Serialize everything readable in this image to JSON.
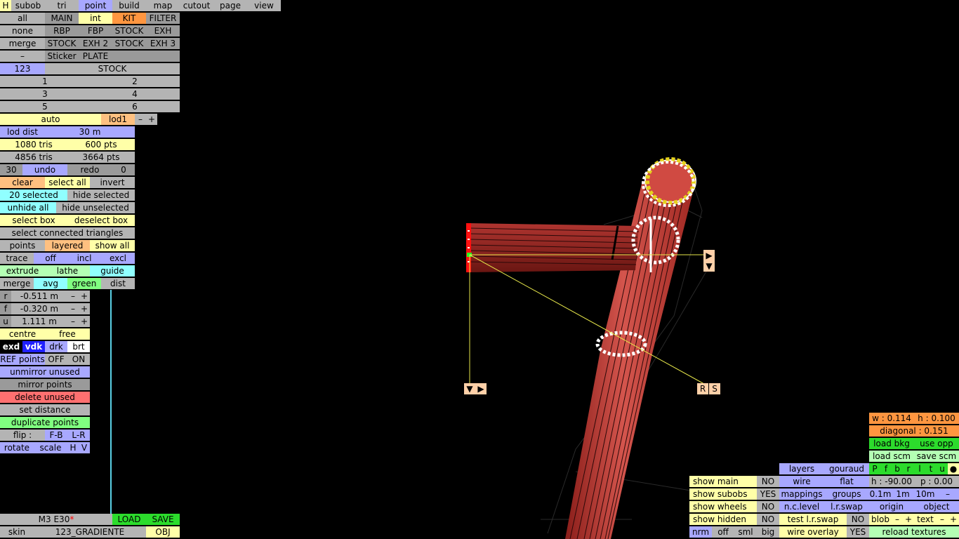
{
  "menu": {
    "h": "H",
    "subob": "subob",
    "tri": "tri",
    "point": "point",
    "build": "build",
    "map": "map",
    "cutout": "cutout",
    "page": "page",
    "view": "view"
  },
  "filter": {
    "rows": [
      [
        "all",
        "MAIN",
        "int",
        "KIT",
        "FILTER"
      ],
      [
        "none",
        "RBP",
        "FBP",
        "STOCK",
        "EXH"
      ],
      [
        "merge",
        "STOCK",
        "EXH 2",
        "STOCK",
        "EXH 3"
      ],
      [
        "–",
        "Sticker",
        "PLATE",
        "",
        ""
      ]
    ],
    "num_label": "123",
    "stock_label": "STOCK",
    "slots": [
      "1",
      "2",
      "3",
      "4",
      "5",
      "6"
    ]
  },
  "lod": {
    "auto": "auto",
    "lod": "lod1",
    "minus": "–",
    "plus": "+",
    "dist_label": "lod dist",
    "dist_value": "30 m",
    "tris_a": "1080 tris",
    "pts_a": "600 pts",
    "tris_b": "4856 tris",
    "pts_b": "3664 pts"
  },
  "history": {
    "undo_count": "30",
    "undo": "undo",
    "redo": "redo",
    "redo_count": "0"
  },
  "selection": {
    "clear": "clear",
    "select_all": "select all",
    "invert": "invert",
    "selected": "20 selected",
    "hide_selected": "hide selected",
    "unhide_all": "unhide all",
    "hide_unselected": "hide unselected",
    "select_box": "select box",
    "deselect_box": "deselect box",
    "select_connected": "select connected triangles",
    "points": "points",
    "layered": "layered",
    "show_all": "show all",
    "trace": "trace",
    "off": "off",
    "incl": "incl",
    "excl": "excl",
    "extrude": "extrude",
    "lathe": "lathe",
    "guide": "guide",
    "merge": "merge",
    "avg": "avg",
    "green": "green",
    "dist": "dist"
  },
  "coords": [
    {
      "axis": "r",
      "value": "-0.511 m"
    },
    {
      "axis": "f",
      "value": "-0.320 m"
    },
    {
      "axis": "u",
      "value": "1.111 m"
    }
  ],
  "centre": {
    "centre": "centre",
    "free": "free"
  },
  "shade": {
    "exd": "exd",
    "vdk": "vdk",
    "drk": "drk",
    "brt": "brt"
  },
  "ref": {
    "label": "REF points",
    "off": "OFF",
    "on": "ON"
  },
  "tools": {
    "unmirror": "unmirror unused",
    "mirror": "mirror points",
    "delete": "delete unused",
    "set_distance": "set distance",
    "duplicate": "duplicate points",
    "flip": "flip :",
    "fb": "F-B",
    "lr": "L-R",
    "rotate": "rotate",
    "scale": "scale",
    "h": "H",
    "v": "V"
  },
  "file": {
    "name": "M3 E30",
    "modified": "*",
    "load": "LOAD",
    "save": "SAVE",
    "skin": "skin",
    "skin_name": "123_GRADIENTE",
    "obj": "OBJ"
  },
  "viewport": {
    "handle_a": "▶",
    "handle_b": "▼",
    "handle_c": "▼",
    "handle_d": "▶",
    "r_label": "R",
    "s_label": "S"
  },
  "info": {
    "w": "w : 0.114",
    "h": "h : 0.100",
    "diagonal": "diagonal : 0.151",
    "load_bkg": "load bkg",
    "use_opp": "use opp",
    "load_scm": "load scm",
    "save_scm": "save scm",
    "views": [
      "P",
      "f",
      "b",
      "r",
      "l",
      "t",
      "u",
      "●"
    ],
    "heading": "h : -90.00",
    "pitch": "p : 0.00",
    "steps": [
      "0.1m",
      "1m",
      "10m",
      "–"
    ],
    "origin": "origin",
    "object": "object",
    "blob": "blob",
    "text": "text",
    "minus": "–",
    "plus": "+",
    "reload": "reload textures"
  },
  "display": {
    "layers": "layers",
    "gouraud": "gouraud",
    "wire": "wire",
    "flat": "flat",
    "mappings": "mappings",
    "groups": "groups",
    "nc_level": "n.c.level",
    "lr_swap": "l.r.swap",
    "test_lr_swap": "test l.r.swap",
    "test_val": "NO",
    "wire_overlay": "wire overlay",
    "overlay_val": "YES",
    "show_main": "show main",
    "main_val": "NO",
    "show_subobs": "show subobs",
    "subobs_val": "YES",
    "show_wheels": "show wheels",
    "wheels_val": "NO",
    "show_hidden": "show hidden",
    "hidden_val": "NO",
    "nrm": "nrm",
    "off": "off",
    "sml": "sml",
    "big": "big"
  },
  "colors": {
    "background": "#000000",
    "tube": "#c8413b",
    "guide_line": "#e6e64a",
    "cyan_line": "#5ad2e6"
  }
}
